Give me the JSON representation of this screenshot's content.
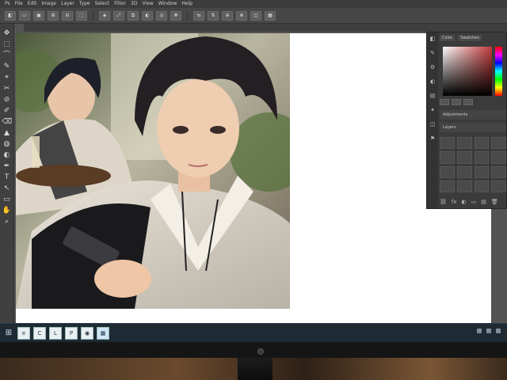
{
  "menubar": {
    "items": [
      "Ps",
      "File",
      "Edit",
      "Image",
      "Layer",
      "Type",
      "Select",
      "Filter",
      "3D",
      "View",
      "Window",
      "Help"
    ]
  },
  "options": {
    "buttons": [
      "◧",
      "▭",
      "▣",
      "⊞",
      "⊟",
      "⬚",
      "◈",
      "⤢",
      "⧉",
      "◐",
      "◎",
      "✥",
      "⇆",
      "⇅",
      "⊕",
      "⊗",
      "◫",
      "▦"
    ]
  },
  "document": {
    "tab_label": ""
  },
  "toolbar": {
    "tools": [
      "✥",
      "⬚",
      "⌒",
      "✎",
      "⌖",
      "✂",
      "⊘",
      "✐",
      "⌫",
      "▲",
      "◍",
      "◐",
      "✒",
      "T",
      "↖",
      "▭",
      "✋",
      "⌕"
    ]
  },
  "panel": {
    "tabs": [
      "Color",
      "Swatches"
    ],
    "sections": [
      "Adjustments",
      "Layers"
    ],
    "side_icons": [
      "◧",
      "✎",
      "⚙",
      "◐",
      "▤",
      "✦",
      "◫",
      "⚑"
    ],
    "foot_buttons": [
      "⛓",
      "fx",
      "◐",
      "▭",
      "▤",
      "🗑"
    ]
  },
  "taskbar": {
    "start_icon": "⊞",
    "apps": [
      "e",
      "C",
      "L",
      "P",
      "◉",
      "▦"
    ]
  },
  "colors": {
    "screen_bg": "#535353",
    "panel_bg": "#3b3b3b",
    "taskbar_bg": "#1e2a34",
    "hue_accent": "#c23a3a"
  }
}
